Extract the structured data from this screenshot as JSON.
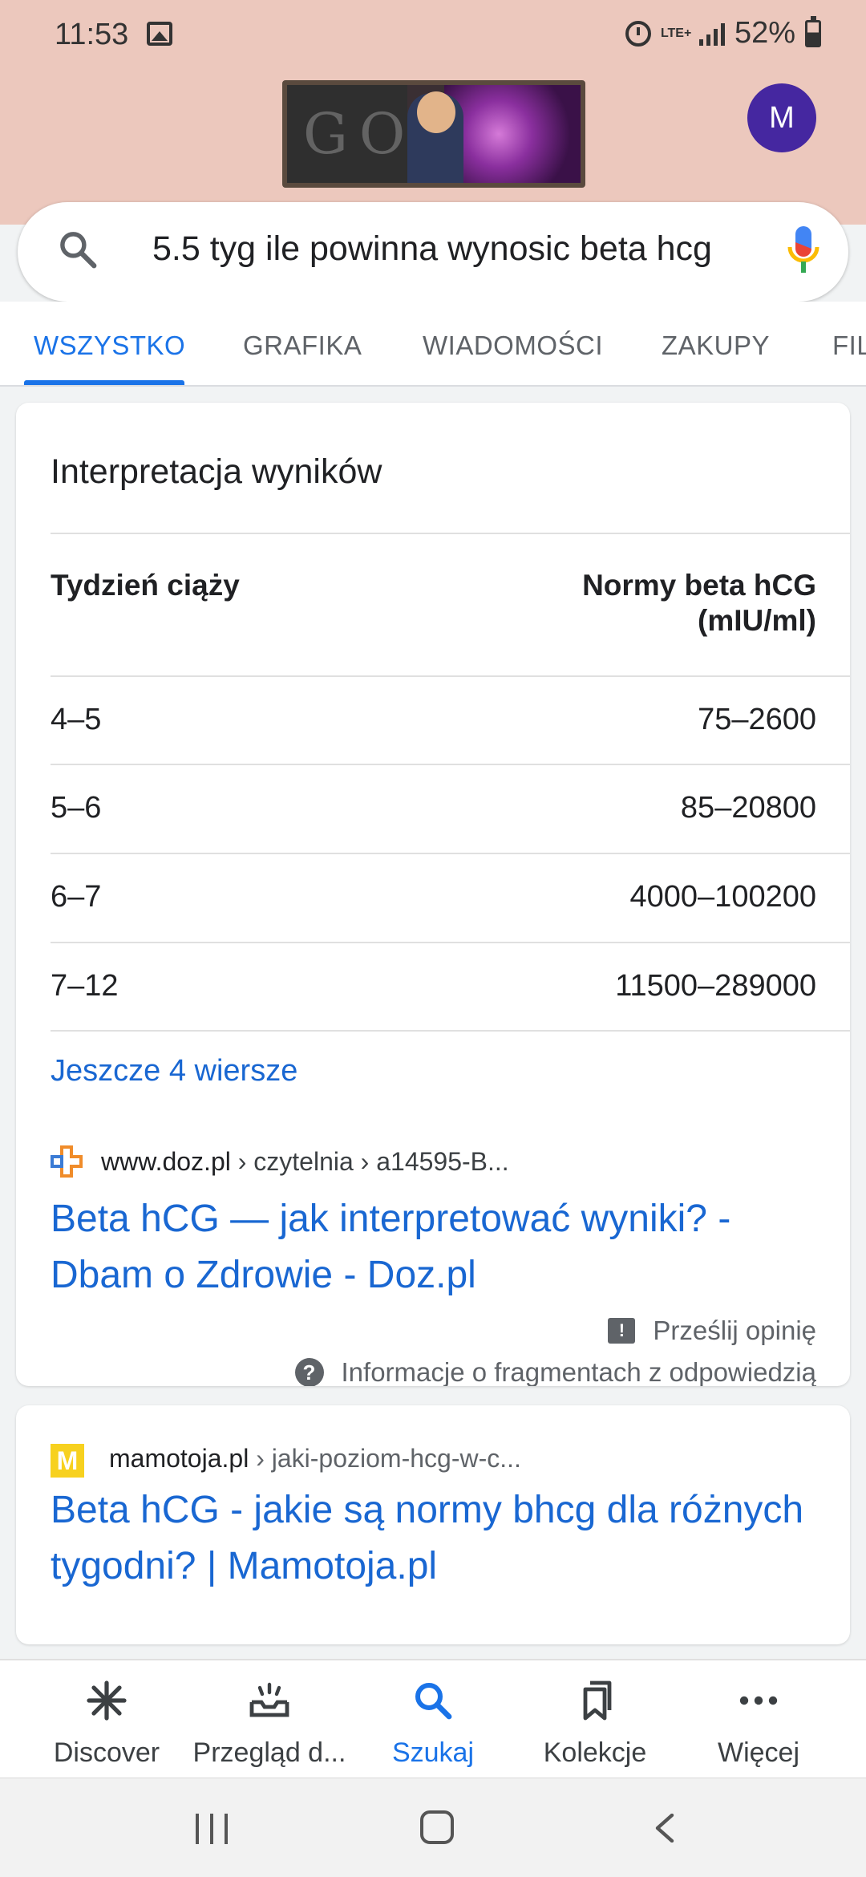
{
  "status_bar": {
    "time": "11:53",
    "network": "LTE+",
    "battery": "52%"
  },
  "header": {
    "doodle": "Google Doodle",
    "avatar_letter": "M"
  },
  "search": {
    "query": "5.5 tyg ile powinna wynosic beta hcg"
  },
  "tabs": [
    {
      "label": "WSZYSTKO",
      "active": true
    },
    {
      "label": "GRAFIKA"
    },
    {
      "label": "WIADOMOŚCI"
    },
    {
      "label": "ZAKUPY"
    },
    {
      "label": "FIL"
    }
  ],
  "snippet": {
    "title": "Interpretacja wyników",
    "table": {
      "headers": [
        "Tydzień ciąży",
        "Normy beta hCG",
        "(mIU/ml)"
      ],
      "rows": [
        [
          "4–5",
          "75–2600"
        ],
        [
          "5–6",
          "85–20800"
        ],
        [
          "6–7",
          "4000–100200"
        ],
        [
          "7–12",
          "11500–289000"
        ]
      ]
    },
    "more_rows": "Jeszcze 4 wiersze",
    "source": {
      "domain": "www.doz.pl",
      "path": " › czytelnia › a14595-B...",
      "title": "Beta hCG — jak interpretować wyniki? - Dbam o Zdrowie - Doz.pl"
    },
    "feedback": "Prześlij opinię",
    "about_snippets": "Informacje o fragmentach z odpowiedzią"
  },
  "result2": {
    "favicon_letter": "M",
    "domain": "mamotoja.pl",
    "path": " › jaki-poziom-hcg-w-c...",
    "title": "Beta hCG - jakie są normy bhcg dla różnych tygodni? | Mamotoja.pl"
  },
  "bottom_nav": [
    {
      "label": "Discover",
      "icon": "asterisk-icon"
    },
    {
      "label": "Przegląd d...",
      "icon": "inbox-tray-icon"
    },
    {
      "label": "Szukaj",
      "icon": "search-icon",
      "active": true
    },
    {
      "label": "Kolekcje",
      "icon": "bookmarks-icon"
    },
    {
      "label": "Więcej",
      "icon": "more-dots-icon"
    }
  ],
  "colors": {
    "header_bg": "#ecc8bd",
    "accent": "#1a73e8",
    "link": "#1967d2",
    "avatar": "#4527a0"
  }
}
